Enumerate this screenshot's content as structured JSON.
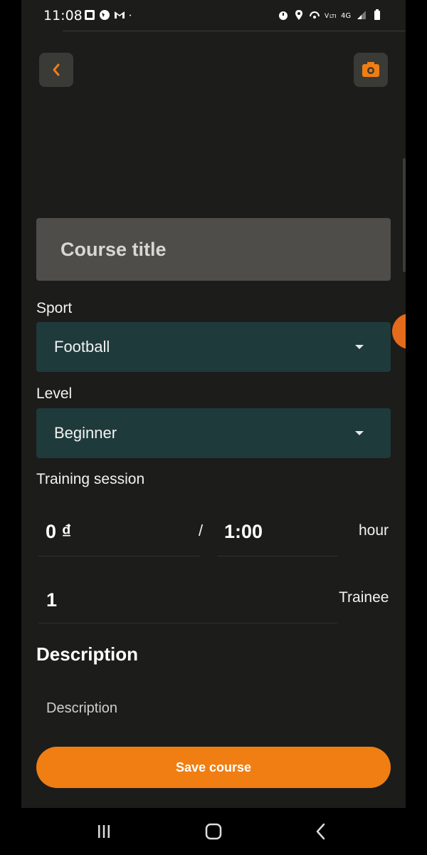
{
  "status_bar": {
    "time": "11:08",
    "left_icons": [
      "gallery-icon",
      "globe-icon",
      "gmail-icon",
      "dot-icon"
    ],
    "right_icons": [
      "alarm-icon",
      "location-icon",
      "hotspot-icon",
      "volte-icon",
      "4g-icon",
      "signal-icon",
      "battery-icon"
    ]
  },
  "header": {
    "back_icon": "chevron-left-icon",
    "camera_icon": "camera-icon",
    "accent_color": "#f07e12"
  },
  "form": {
    "title_placeholder": "Course title",
    "sport_label": "Sport",
    "sport_value": "Football",
    "level_label": "Level",
    "level_value": "Beginner",
    "training_label": "Training session",
    "price_value": "0 ₫",
    "slash": "/",
    "duration_value": "1:00",
    "duration_unit": "hour",
    "trainee_value": "1",
    "trainee_unit": "Trainee",
    "description_heading": "Description",
    "description_placeholder": "Description",
    "save_label": "Save course"
  },
  "nav_bar": {
    "recents_icon": "recents-icon",
    "home_icon": "home-icon",
    "back_icon": "back-icon"
  }
}
